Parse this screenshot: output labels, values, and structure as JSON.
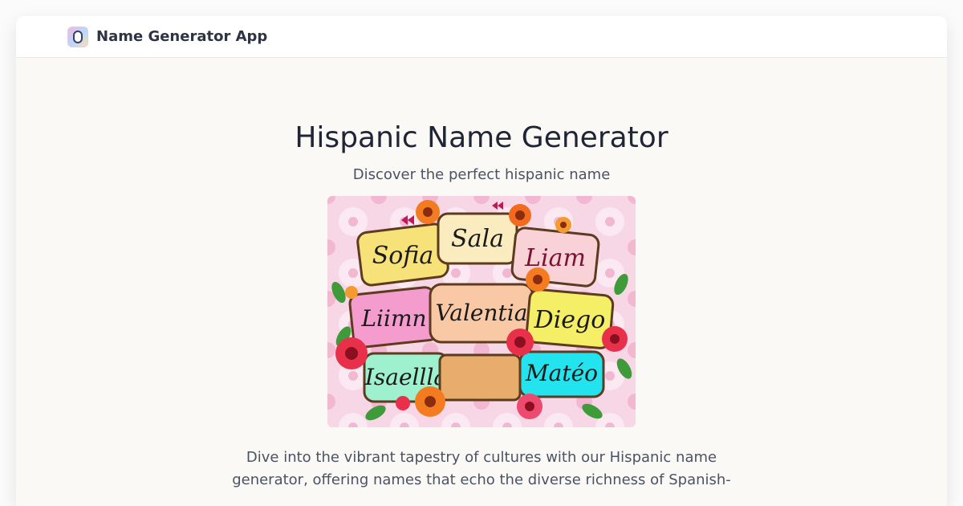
{
  "header": {
    "app_name": "Name Generator App",
    "logo_icon": "app-logo-icon"
  },
  "main": {
    "title": "Hispanic Name Generator",
    "subtitle": "Discover the perfect hispanic name",
    "image": {
      "names": [
        "Sofia",
        "Sala",
        "Liam",
        "Liimn",
        "Valentia",
        "Diego",
        "Isaellla",
        "Matéo"
      ]
    },
    "description": "Dive into the vibrant tapestry of cultures with our Hispanic name generator, offering names that echo the diverse richness of Spanish-"
  },
  "colors": {
    "page_bg": "#faf9f6",
    "header_bg": "#ffffff",
    "title": "#1f2535",
    "body_text": "#4b5263"
  }
}
